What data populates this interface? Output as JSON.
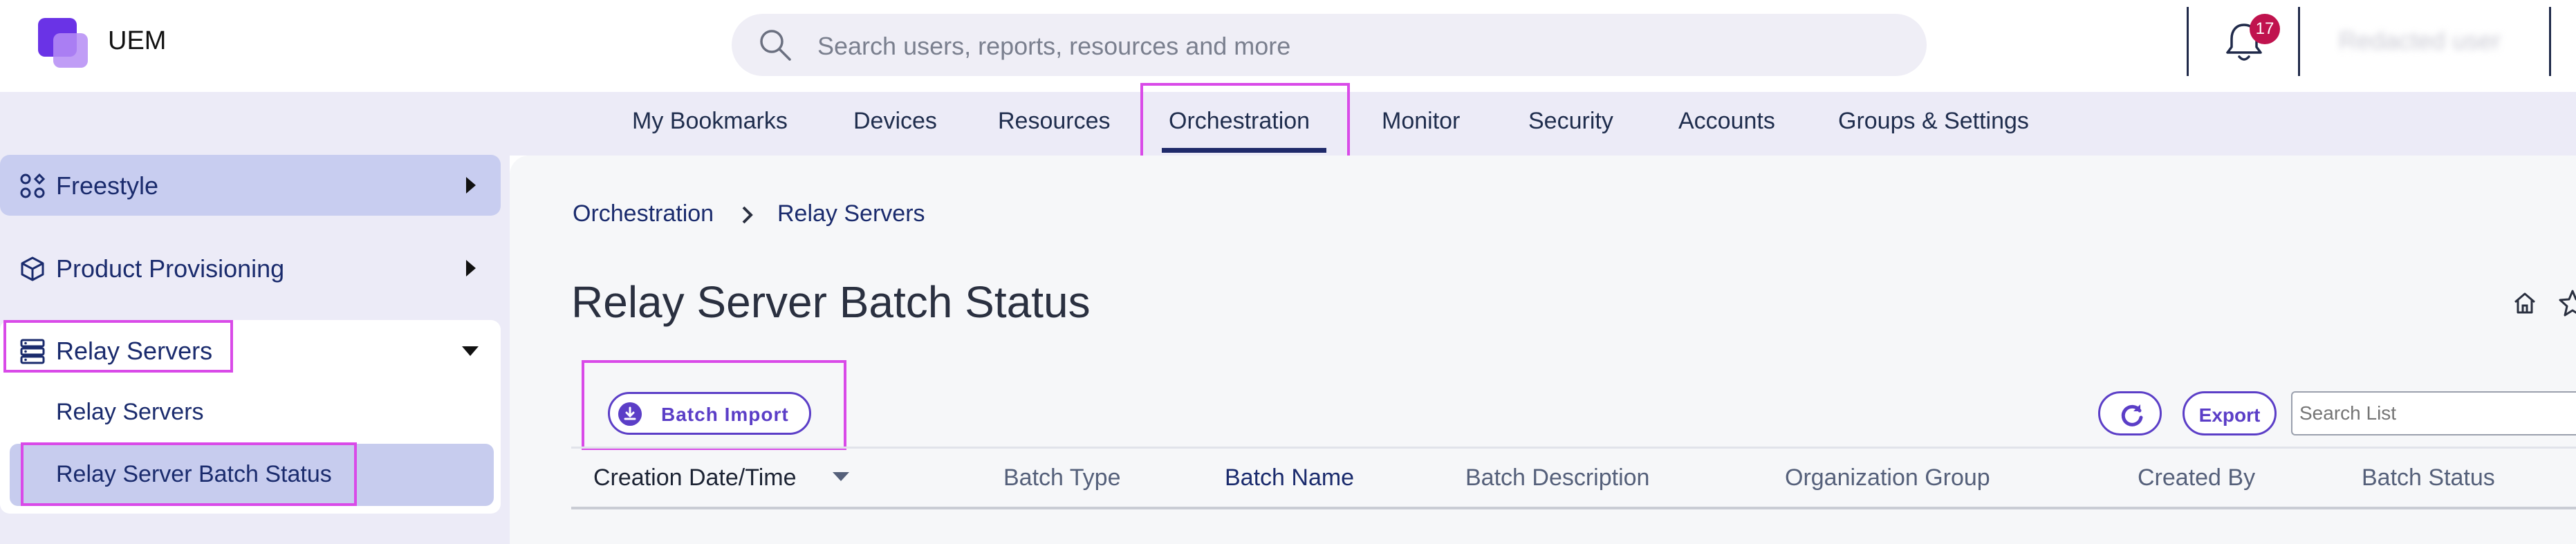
{
  "header": {
    "app_title": "UEM",
    "search_placeholder": "Search users, reports, resources and more",
    "notification_count": "17",
    "user_name": "Redacted user"
  },
  "nav": {
    "items": [
      {
        "label": "My Bookmarks"
      },
      {
        "label": "Devices"
      },
      {
        "label": "Resources"
      },
      {
        "label": "Orchestration",
        "active": true
      },
      {
        "label": "Monitor"
      },
      {
        "label": "Security"
      },
      {
        "label": "Accounts"
      },
      {
        "label": "Groups & Settings"
      }
    ]
  },
  "sidebar": {
    "items": [
      {
        "label": "Freestyle",
        "icon": "freestyle-icon"
      },
      {
        "label": "Product Provisioning",
        "icon": "box-icon"
      },
      {
        "label": "Relay Servers",
        "icon": "server-icon",
        "expanded": true
      }
    ],
    "sub_items": [
      {
        "label": "Relay Servers"
      },
      {
        "label": "Relay Server Batch Status",
        "active": true
      }
    ]
  },
  "breadcrumb": {
    "items": [
      "Orchestration",
      "Relay Servers"
    ]
  },
  "page": {
    "title": "Relay Server Batch Status"
  },
  "toolbar": {
    "batch_import_label": "Batch Import",
    "export_label": "Export",
    "search_placeholder": "Search List"
  },
  "table": {
    "columns": [
      "Creation Date/Time",
      "Batch Type",
      "Batch Name",
      "Batch Description",
      "Organization Group",
      "Created By",
      "Batch Status"
    ],
    "sort_column": "Creation Date/Time",
    "sort_direction": "descending"
  },
  "colors": {
    "accent": "#5b3ec7",
    "nav_band": "#ecebf7",
    "highlight_box": "#d94ae8",
    "badge": "#c0134e",
    "active_subitem_bg": "#c7ccee"
  }
}
